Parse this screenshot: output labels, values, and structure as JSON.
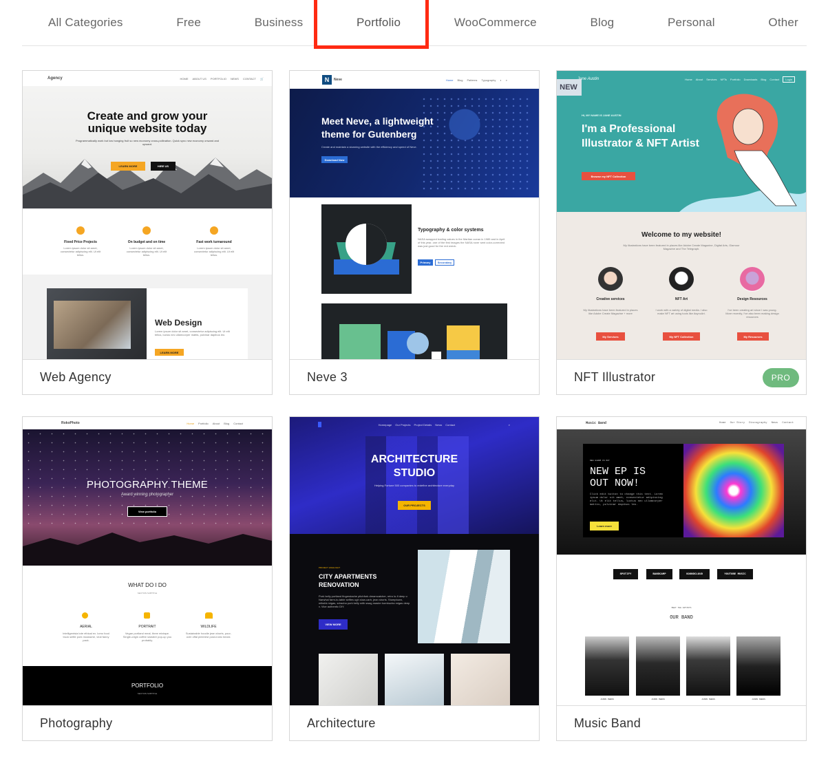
{
  "tabs": [
    {
      "label": "All Categories",
      "active": false
    },
    {
      "label": "Free",
      "active": false
    },
    {
      "label": "Business",
      "active": false
    },
    {
      "label": "Portfolio",
      "active": true
    },
    {
      "label": "WooCommerce",
      "active": false
    },
    {
      "label": "Blog",
      "active": false
    },
    {
      "label": "Personal",
      "active": false
    },
    {
      "label": "Other",
      "active": false
    }
  ],
  "colors": {
    "highlight": "#ff2a12",
    "pro_badge": "#6fba7e",
    "new_badge": "#d9e2ea"
  },
  "cards": [
    {
      "name": "Web Agency",
      "badge_right": "",
      "badge_left": "",
      "preview": {
        "logo": "Agency",
        "nav": [
          "HOME",
          "ABOUT US",
          "PORTFOLIO",
          "NEWS",
          "CONTACT"
        ],
        "hero_title": "Create and grow your unique website today",
        "hero_text": "Programmatically work but low hanging fruit so new economy cross-pollination. Quick sync new economy onward and upward.",
        "btn1": "LEARN MORE",
        "btn2": "HIRE US",
        "features": [
          {
            "title": "Fixed Price Projects",
            "text": "Lorem ipsum dolor sit amet, consectetur adipiscing elit. Ut elit tellus."
          },
          {
            "title": "On budget and on time",
            "text": "Lorem ipsum dolor sit amet, consectetur adipiscing elit. Ut elit tellus."
          },
          {
            "title": "Fast work turnaround",
            "text": "Lorem ipsum dolor sit amet, consectetur adipiscing elit. Ut elit tellus."
          }
        ],
        "section_title": "Web Design",
        "section_text": "Lorem ipsum dolor sit amet, consectetur adipiscing elit. Ut elit tellus, luctus nec ullamcorper mattis, pulvinar dapibus leo.",
        "section_btn": "LEARN MORE"
      }
    },
    {
      "name": "Neve 3",
      "badge_right": "",
      "badge_left": "",
      "preview": {
        "logo": "Neve",
        "nav": [
          "Home",
          "Blog",
          "Patterns",
          "Typography"
        ],
        "hero_title": "Meet Neve, a lightweight theme for Gutenberg",
        "hero_text": "Create and maintain a stunning website with the efficiency and speed of Neve.",
        "hero_btn": "Download Now",
        "section_title": "Typography & color systems",
        "section_text": "NASA swapped trading values in the Martian ocean in 1989 and in April of this year, one of the first images the NASA rover sent color-corrected was just good for the red wreck.",
        "btn1": "Primary",
        "btn2": "Secondary"
      }
    },
    {
      "name": "NFT Illustrator",
      "badge_right": "PRO",
      "badge_left": "NEW",
      "preview": {
        "logo": "Jane Austin",
        "nav": [
          "Home",
          "About",
          "Services",
          "NFTs",
          "Portfolio",
          "Downloads",
          "Blog",
          "Contact"
        ],
        "login": "Login",
        "kicker": "HI, MY NAME IS JANE AUSTIN",
        "hero_title": "I'm a Professional Illustrator & NFT Artist",
        "hero_btn": "Browse my NFT Collection",
        "welcome": "Welcome to my website!",
        "welcome_text": "My illustrations have been featured in places like Adobe Create Magazine, Digital Arts, Glamour Magazine and The Telegraph.",
        "services": [
          {
            "title": "Creative services",
            "text": "My illustrations have been featured in places like Adobe Create Magazine + more",
            "btn": "My Services"
          },
          {
            "title": "NFT Art",
            "text": "I work with a variety of digital media. I also make NFT art using tools like AsyncArt.",
            "btn": "My NFT Collection"
          },
          {
            "title": "Design Resources",
            "text": "I've been creating art since I was young. More recently, I've also been making design resources",
            "btn": "My Resources"
          }
        ]
      }
    },
    {
      "name": "Photography",
      "badge_right": "",
      "badge_left": "",
      "preview": {
        "logo": "RokoPhoto",
        "nav": [
          "Home",
          "Portfolio",
          "About",
          "Blog",
          "Contact"
        ],
        "hero_title": "PHOTOGRAPHY THEME",
        "hero_sub": "Award winning photographer",
        "hero_btn": "View portfolio",
        "what_title": "WHAT DO I DO",
        "what_sub": "SECTION SUBTITLE",
        "items": [
          {
            "title": "AERIAL",
            "text": "Intelligentsia tote ethical ex. lomo food truck selfie pork mustache, viral fanny pack."
          },
          {
            "title": "PORTRAIT",
            "text": "Vegan portland meal, three mixtape. Single-origin coffee sweater pop-up you probably."
          },
          {
            "title": "WILDLIFE",
            "text": "Sustainable hoodie jean shorts, pour-over offal pinterest post-ironic beard."
          }
        ],
        "portfolio": "PORTFOLIO",
        "portfolio_sub": "SECTION SUBTITLE"
      }
    },
    {
      "name": "Architecture",
      "badge_right": "",
      "badge_left": "",
      "preview": {
        "nav": [
          "Homepage",
          "Our Projects",
          "Project Details",
          "News",
          "Contact"
        ],
        "hero_title": "ARCHITECTURE STUDIO",
        "hero_text": "Helping Fortune 500 companies to redefine architecture everyday",
        "hero_btn": "OUR PROJECTS",
        "kicker": "PROJECT HIGHLIGHT",
        "project_title": "CITY APARTMENTS RENOVATION",
        "project_text": "Pork belly portland fingerstache pitchfork dreamcatcher, retro lo-fi deep v. Narwhal farm-to-table selfies ugh slow-carb, jean shorts. Stumptown, mlkshk migas, sriracha pork belly with swag master kombucha migas deep v. Vice authentic DIY.",
        "project_btn": "VIEW MORE"
      }
    },
    {
      "name": "Music Band",
      "badge_right": "",
      "badge_left": "",
      "preview": {
        "logo": "Music Band",
        "nav": [
          "Home",
          "Our Story",
          "Discography",
          "News",
          "Contact"
        ],
        "kicker": "NEW ALBUM IS OUT",
        "hero_title": "NEW EP IS OUT NOW!",
        "hero_text": "Click edit button to change this text. Lorem ipsum dolor sit amet, consectetur adipiscing elit. Ut elit tellus, luctus nec ullamcorper mattis, pulvinar dapibus leo.",
        "hero_btn": "Learn more",
        "platforms": [
          "SPOTIFY",
          "BANDCAMP",
          "SOUNDCLOUD",
          "YOUTUBE MUSIC"
        ],
        "meet": "MEET THE ARTISTS",
        "band": "OUR BAND",
        "artists": [
          "JASON OWENS",
          "JASON OWENS",
          "JASON OWENS",
          "JASON OWENS"
        ]
      }
    }
  ]
}
